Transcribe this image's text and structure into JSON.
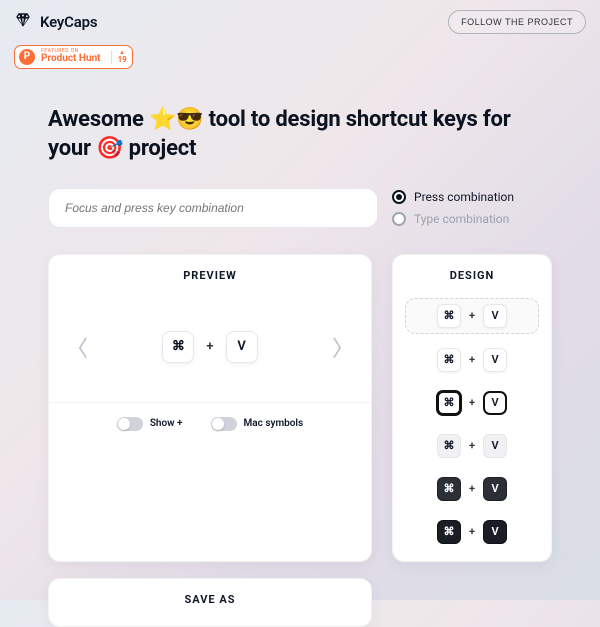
{
  "brand": {
    "name": "KeyCaps"
  },
  "header": {
    "follow_label": "FOLLOW THE PROJECT"
  },
  "product_hunt": {
    "featured_label": "FEATURED ON",
    "name": "Product Hunt",
    "upvotes": "19"
  },
  "hero": {
    "text": "Awesome ⭐😎 tool to design shortcut keys for your 🎯 project"
  },
  "input": {
    "placeholder": "Focus and press key combination"
  },
  "modes": {
    "items": [
      {
        "label": "Press combination",
        "checked": true
      },
      {
        "label": "Type combination",
        "checked": false
      }
    ]
  },
  "preview": {
    "title": "PREVIEW",
    "keys": {
      "modifier": "⌘",
      "plus": "+",
      "key": "V"
    },
    "toggles": [
      {
        "label": "Show +"
      },
      {
        "label": "Mac symbols"
      }
    ]
  },
  "design": {
    "title": "DESIGN",
    "variants": [
      {
        "active": true,
        "modifier": "⌘",
        "plus": "+",
        "key": "V",
        "style": "st1"
      },
      {
        "active": false,
        "modifier": "⌘",
        "plus": "+",
        "key": "V",
        "style": "st1"
      },
      {
        "active": false,
        "modifier": "⌘",
        "plus": "+",
        "key": "V",
        "style": "st3"
      },
      {
        "active": false,
        "modifier": "⌘",
        "plus": "+",
        "key": "V",
        "style": "st4"
      },
      {
        "active": false,
        "modifier": "⌘",
        "plus": "+",
        "key": "V",
        "style": "st5"
      },
      {
        "active": false,
        "modifier": "⌘",
        "plus": "+",
        "key": "V",
        "style": "st6"
      }
    ]
  },
  "save": {
    "title": "SAVE AS"
  }
}
